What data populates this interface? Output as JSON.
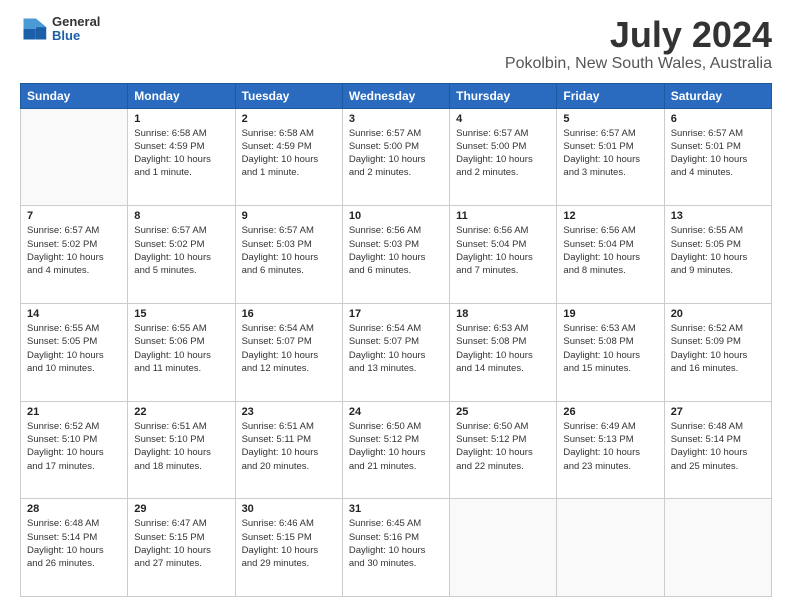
{
  "header": {
    "logo_general": "General",
    "logo_blue": "Blue",
    "title": "July 2024",
    "subtitle": "Pokolbin, New South Wales, Australia"
  },
  "weekdays": [
    "Sunday",
    "Monday",
    "Tuesday",
    "Wednesday",
    "Thursday",
    "Friday",
    "Saturday"
  ],
  "weeks": [
    [
      {
        "day": "",
        "info": ""
      },
      {
        "day": "1",
        "info": "Sunrise: 6:58 AM\nSunset: 4:59 PM\nDaylight: 10 hours\nand 1 minute."
      },
      {
        "day": "2",
        "info": "Sunrise: 6:58 AM\nSunset: 4:59 PM\nDaylight: 10 hours\nand 1 minute."
      },
      {
        "day": "3",
        "info": "Sunrise: 6:57 AM\nSunset: 5:00 PM\nDaylight: 10 hours\nand 2 minutes."
      },
      {
        "day": "4",
        "info": "Sunrise: 6:57 AM\nSunset: 5:00 PM\nDaylight: 10 hours\nand 2 minutes."
      },
      {
        "day": "5",
        "info": "Sunrise: 6:57 AM\nSunset: 5:01 PM\nDaylight: 10 hours\nand 3 minutes."
      },
      {
        "day": "6",
        "info": "Sunrise: 6:57 AM\nSunset: 5:01 PM\nDaylight: 10 hours\nand 4 minutes."
      }
    ],
    [
      {
        "day": "7",
        "info": "Sunrise: 6:57 AM\nSunset: 5:02 PM\nDaylight: 10 hours\nand 4 minutes."
      },
      {
        "day": "8",
        "info": "Sunrise: 6:57 AM\nSunset: 5:02 PM\nDaylight: 10 hours\nand 5 minutes."
      },
      {
        "day": "9",
        "info": "Sunrise: 6:57 AM\nSunset: 5:03 PM\nDaylight: 10 hours\nand 6 minutes."
      },
      {
        "day": "10",
        "info": "Sunrise: 6:56 AM\nSunset: 5:03 PM\nDaylight: 10 hours\nand 6 minutes."
      },
      {
        "day": "11",
        "info": "Sunrise: 6:56 AM\nSunset: 5:04 PM\nDaylight: 10 hours\nand 7 minutes."
      },
      {
        "day": "12",
        "info": "Sunrise: 6:56 AM\nSunset: 5:04 PM\nDaylight: 10 hours\nand 8 minutes."
      },
      {
        "day": "13",
        "info": "Sunrise: 6:55 AM\nSunset: 5:05 PM\nDaylight: 10 hours\nand 9 minutes."
      }
    ],
    [
      {
        "day": "14",
        "info": "Sunrise: 6:55 AM\nSunset: 5:05 PM\nDaylight: 10 hours\nand 10 minutes."
      },
      {
        "day": "15",
        "info": "Sunrise: 6:55 AM\nSunset: 5:06 PM\nDaylight: 10 hours\nand 11 minutes."
      },
      {
        "day": "16",
        "info": "Sunrise: 6:54 AM\nSunset: 5:07 PM\nDaylight: 10 hours\nand 12 minutes."
      },
      {
        "day": "17",
        "info": "Sunrise: 6:54 AM\nSunset: 5:07 PM\nDaylight: 10 hours\nand 13 minutes."
      },
      {
        "day": "18",
        "info": "Sunrise: 6:53 AM\nSunset: 5:08 PM\nDaylight: 10 hours\nand 14 minutes."
      },
      {
        "day": "19",
        "info": "Sunrise: 6:53 AM\nSunset: 5:08 PM\nDaylight: 10 hours\nand 15 minutes."
      },
      {
        "day": "20",
        "info": "Sunrise: 6:52 AM\nSunset: 5:09 PM\nDaylight: 10 hours\nand 16 minutes."
      }
    ],
    [
      {
        "day": "21",
        "info": "Sunrise: 6:52 AM\nSunset: 5:10 PM\nDaylight: 10 hours\nand 17 minutes."
      },
      {
        "day": "22",
        "info": "Sunrise: 6:51 AM\nSunset: 5:10 PM\nDaylight: 10 hours\nand 18 minutes."
      },
      {
        "day": "23",
        "info": "Sunrise: 6:51 AM\nSunset: 5:11 PM\nDaylight: 10 hours\nand 20 minutes."
      },
      {
        "day": "24",
        "info": "Sunrise: 6:50 AM\nSunset: 5:12 PM\nDaylight: 10 hours\nand 21 minutes."
      },
      {
        "day": "25",
        "info": "Sunrise: 6:50 AM\nSunset: 5:12 PM\nDaylight: 10 hours\nand 22 minutes."
      },
      {
        "day": "26",
        "info": "Sunrise: 6:49 AM\nSunset: 5:13 PM\nDaylight: 10 hours\nand 23 minutes."
      },
      {
        "day": "27",
        "info": "Sunrise: 6:48 AM\nSunset: 5:14 PM\nDaylight: 10 hours\nand 25 minutes."
      }
    ],
    [
      {
        "day": "28",
        "info": "Sunrise: 6:48 AM\nSunset: 5:14 PM\nDaylight: 10 hours\nand 26 minutes."
      },
      {
        "day": "29",
        "info": "Sunrise: 6:47 AM\nSunset: 5:15 PM\nDaylight: 10 hours\nand 27 minutes."
      },
      {
        "day": "30",
        "info": "Sunrise: 6:46 AM\nSunset: 5:15 PM\nDaylight: 10 hours\nand 29 minutes."
      },
      {
        "day": "31",
        "info": "Sunrise: 6:45 AM\nSunset: 5:16 PM\nDaylight: 10 hours\nand 30 minutes."
      },
      {
        "day": "",
        "info": ""
      },
      {
        "day": "",
        "info": ""
      },
      {
        "day": "",
        "info": ""
      }
    ]
  ]
}
